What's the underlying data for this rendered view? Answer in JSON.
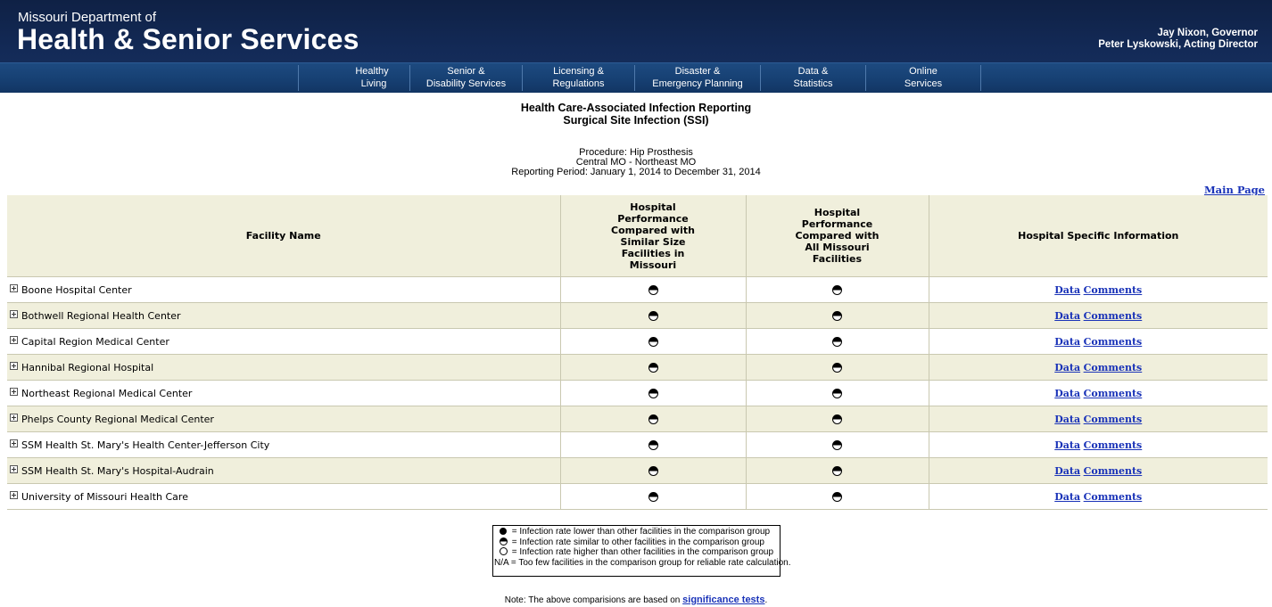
{
  "header": {
    "agency_line1": "Missouri Department of",
    "agency_line2": "Health & Senior Services",
    "governor": "Jay Nixon, Governor",
    "director": "Peter Lyskowski, Acting Director"
  },
  "nav": [
    {
      "line1": "Healthy",
      "line2": "Living"
    },
    {
      "line1": "Senior &",
      "line2": "Disability Services"
    },
    {
      "line1": "Licensing &",
      "line2": "Regulations"
    },
    {
      "line1": "Disaster &",
      "line2": "Emergency Planning"
    },
    {
      "line1": "Data &",
      "line2": "Statistics"
    },
    {
      "line1": "Online",
      "line2": "Services"
    }
  ],
  "title": {
    "line1": "Health Care-Associated Infection Reporting",
    "line2": "Surgical Site Infection (SSI)",
    "procedure": "Procedure: Hip Prosthesis",
    "region": "Central MO - Northeast MO",
    "period": "Reporting Period: January 1, 2014 to December 31, 2014"
  },
  "main_page_link": "Main Page",
  "table": {
    "headers": {
      "facility": "Facility Name",
      "similar": "Hospital Performance Compared with Similar Size Facilities in Missouri",
      "all": "Hospital Performance Compared with All Missouri Facilities",
      "info": "Hospital Specific Information"
    },
    "data_label": "Data",
    "comments_label": "Comments",
    "rows": [
      {
        "name": "Boone Hospital Center",
        "similar": "similar",
        "all": "similar"
      },
      {
        "name": "Bothwell Regional Health Center",
        "similar": "similar",
        "all": "similar"
      },
      {
        "name": "Capital Region Medical Center",
        "similar": "similar",
        "all": "similar"
      },
      {
        "name": "Hannibal Regional Hospital",
        "similar": "similar",
        "all": "similar"
      },
      {
        "name": "Northeast Regional Medical Center",
        "similar": "similar",
        "all": "similar"
      },
      {
        "name": "Phelps County Regional Medical Center",
        "similar": "similar",
        "all": "similar"
      },
      {
        "name": "SSM Health St. Mary's Health Center-Jefferson City",
        "similar": "similar",
        "all": "similar"
      },
      {
        "name": "SSM Health St. Mary's Hospital-Audrain",
        "similar": "similar",
        "all": "similar"
      },
      {
        "name": "University of Missouri Health Care",
        "similar": "similar",
        "all": "similar"
      }
    ]
  },
  "legend": {
    "lower": "= Infection rate lower than other facilities in the comparison group",
    "similar": "= Infection rate similar to other facilities in the comparison group",
    "higher": "= Infection rate higher than other facilities in the comparison group",
    "na_symbol": "N/A",
    "na": "= Too few facilities in the comparison group for reliable rate calculation."
  },
  "note": {
    "prefix": "Note: The above comparisions are based on ",
    "link": "significance tests",
    "suffix": "."
  }
}
